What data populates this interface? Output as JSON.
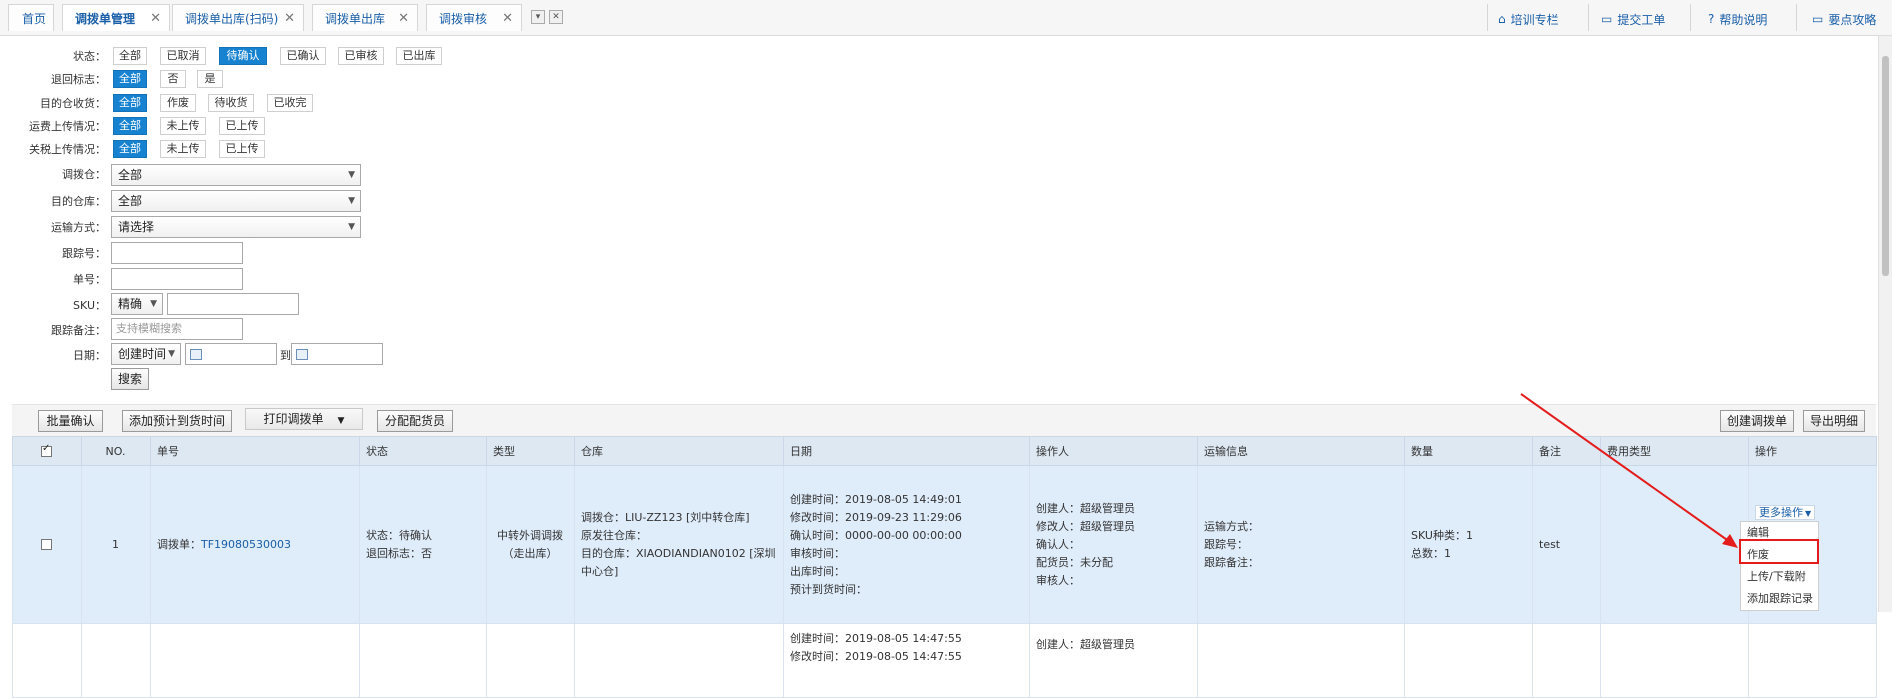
{
  "tabs": [
    {
      "label": "首页",
      "closable": false,
      "active": false
    },
    {
      "label": "调拨单管理",
      "closable": true,
      "active": true
    },
    {
      "label": "调拨单出库(扫码)",
      "closable": true,
      "active": false
    },
    {
      "label": "调拨单出库",
      "closable": true,
      "active": false
    },
    {
      "label": "调拨审核",
      "closable": true,
      "active": false
    }
  ],
  "header_links": [
    "培训专栏",
    "提交工单",
    "帮助说明",
    "要点攻略"
  ],
  "filters": {
    "status": {
      "label": "状态：",
      "options": [
        "全部",
        "已取消",
        "待确认",
        "已确认",
        "已审核",
        "已出库"
      ],
      "selected": "待确认"
    },
    "return_flag": {
      "label": "退回标志：",
      "options": [
        "全部",
        "否",
        "是"
      ],
      "selected": "全部"
    },
    "dest_receive": {
      "label": "目的仓收货：",
      "options": [
        "全部",
        "作废",
        "待收货",
        "已收完"
      ],
      "selected": "全部"
    },
    "freight_upload": {
      "label": "运费上传情况：",
      "options": [
        "全部",
        "未上传",
        "已上传"
      ],
      "selected": "全部"
    },
    "tariff_upload": {
      "label": "关税上传情况：",
      "options": [
        "全部",
        "未上传",
        "已上传"
      ],
      "selected": "全部"
    },
    "source_wh": {
      "label": "调拨仓：",
      "value": "全部"
    },
    "dest_wh": {
      "label": "目的仓库：",
      "value": "全部"
    },
    "transport": {
      "label": "运输方式：",
      "value": "请选择"
    },
    "tracking": {
      "label": "跟踪号：",
      "value": ""
    },
    "order_no": {
      "label": "单号：",
      "value": ""
    },
    "sku": {
      "label": "SKU：",
      "mode": "精确",
      "value": ""
    },
    "track_note": {
      "label": "跟踪备注：",
      "placeholder": "支持模糊搜索"
    },
    "date": {
      "label": "日期：",
      "type": "创建时间",
      "to": "到"
    },
    "search_button": "搜索"
  },
  "toolbar": {
    "left_buttons": [
      "批量确认",
      "添加预计到货时间",
      "打印调拨单",
      "分配配货员"
    ],
    "right_buttons": [
      "创建调拨单",
      "导出明细"
    ]
  },
  "table": {
    "headers": [
      "NO.",
      "单号",
      "状态",
      "类型",
      "仓库",
      "日期",
      "操作人",
      "运输信息",
      "数量",
      "备注",
      "费用类型",
      "操作"
    ],
    "rows": [
      {
        "no": "1",
        "order_prefix": "调拨单：",
        "order_no": "TF19080530003",
        "status": [
          "状态：待确认",
          "退回标志：否"
        ],
        "type": [
          "中转外调调拨",
          "（走出库）"
        ],
        "warehouse": [
          "调拨仓：LIU-ZZ123 [刘中转仓库]",
          "原发往仓库：",
          "目的仓库：XIAODIANDIAN0102 [深圳",
          "中心仓]"
        ],
        "dates": [
          "创建时间：2019-08-05 14:49:01",
          "修改时间：2019-09-23 11:29:06",
          "确认时间：0000-00-00 00:00:00",
          "审核时间：",
          "出库时间：",
          "预计到货时间："
        ],
        "operators": [
          "创建人：超级管理员",
          "修改人：超级管理员",
          "确认人：",
          "配货员：未分配",
          "审核人："
        ],
        "transport": [
          "运输方式：",
          "跟踪号：",
          "跟踪备注："
        ],
        "quantity": [
          "SKU种类：1",
          "总数：1"
        ],
        "remark": "test",
        "fee_type": "",
        "action_label": "更多操作"
      },
      {
        "dates": [
          "创建时间：2019-08-05 14:47:55",
          "修改时间：2019-08-05 14:47:55"
        ],
        "operators": [
          "创建人：超级管理员"
        ]
      }
    ]
  },
  "action_menu": [
    "编辑",
    "作废",
    "上传/下载附",
    "添加跟踪记录"
  ],
  "colors": {
    "accent": "#1782cf",
    "link": "#1a5fa8",
    "highlight": "#e41c1c",
    "row_selected": "#dfecfa"
  }
}
